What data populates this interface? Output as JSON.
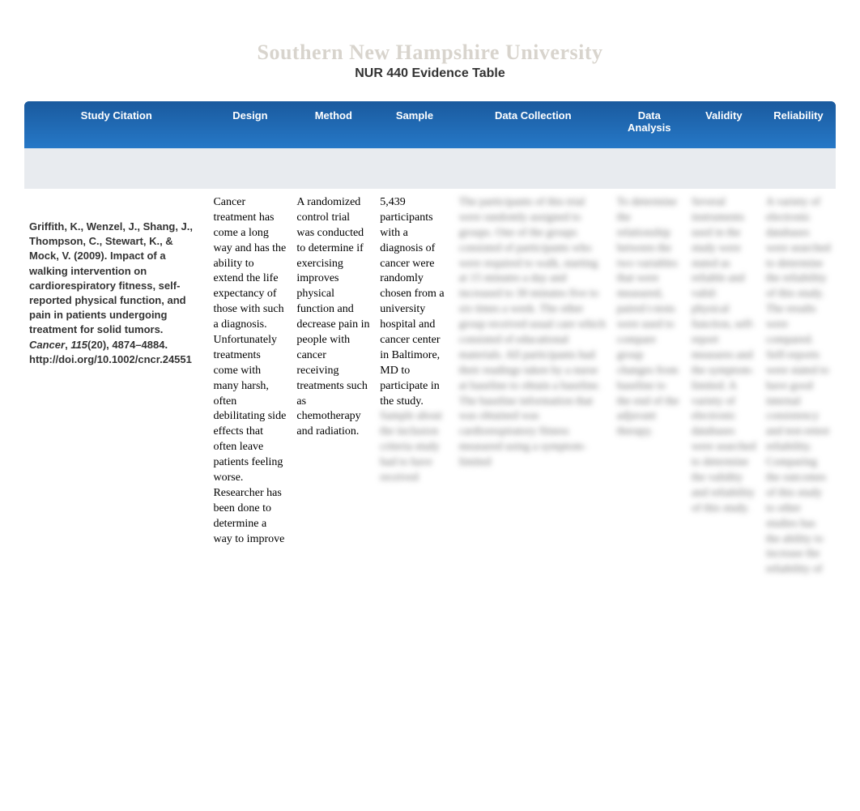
{
  "header": {
    "watermark": "Southern New Hampshire University",
    "title": "NUR 440 Evidence Table"
  },
  "table": {
    "columns": [
      "Study Citation",
      "Design",
      "Method",
      "Sample",
      "Data Collection",
      "Data Analysis",
      "Validity",
      "Reliability"
    ],
    "row": {
      "citation": {
        "authors": "Griffith, K., Wenzel, J., Shang, J., Thompson, C., Stewart, K., & Mock, V. (2009). Impact of a walking intervention on cardiorespiratory fitness, self-reported physical function, and pain in patients undergoing treatment for solid tumors. ",
        "journal": "Cancer",
        "comma": ", ",
        "volume": "115",
        "pages": "(20), 4874–4884. http://doi.org/10.1002/cncr.24551"
      },
      "design": "Cancer treatment has come a long way and has the ability to extend the life expectancy of those with such a diagnosis. Unfortunately treatments come with many harsh, often debilitating side effects that often leave patients feeling worse. Researcher has been done to determine a way to improve",
      "method": "A randomized control trial was conducted to determine if exercising improves physical function and decrease pain in people with cancer receiving treatments such as chemotherapy and radiation.",
      "sample": "5,439 participants with a diagnosis of cancer were randomly chosen from a university hospital and cancer center in Baltimore, MD to participate in the study.",
      "sample_obscured": "Sample about the inclusion criteria study had to have received",
      "datacoll_obscured": "The participants of this trial were randomly assigned to groups. One of the groups consisted of participants who were required to walk, starting at 15 minutes a day and increased to 30 minutes five to six times a week. The other group received usual care which consisted of educational materials. All participants had their readings taken by a nurse at baseline to obtain a baseline. The baseline information that was obtained was cardiorespiratory fitness measured using a symptom-limited",
      "analysis_obscured": "To determine the relationship between the two variables that were measured, paired t-tests were used to compare group changes from baseline to the end of the adjuvant therapy.",
      "validity_obscured": "Several instruments used in the study were stated as reliable and valid: physical function, self-report measures and the symptom-limited. A variety of electronic databases were searched to determine the validity and reliability of this study.",
      "reliability_obscured": "A variety of electronic databases were searched to determine the reliability of this study. The results were compared. Self-reports were stated to have good internal consistency and test-retest reliability. Comparing the outcomes of this study to other studies has the ability to increase the reliability of"
    }
  }
}
